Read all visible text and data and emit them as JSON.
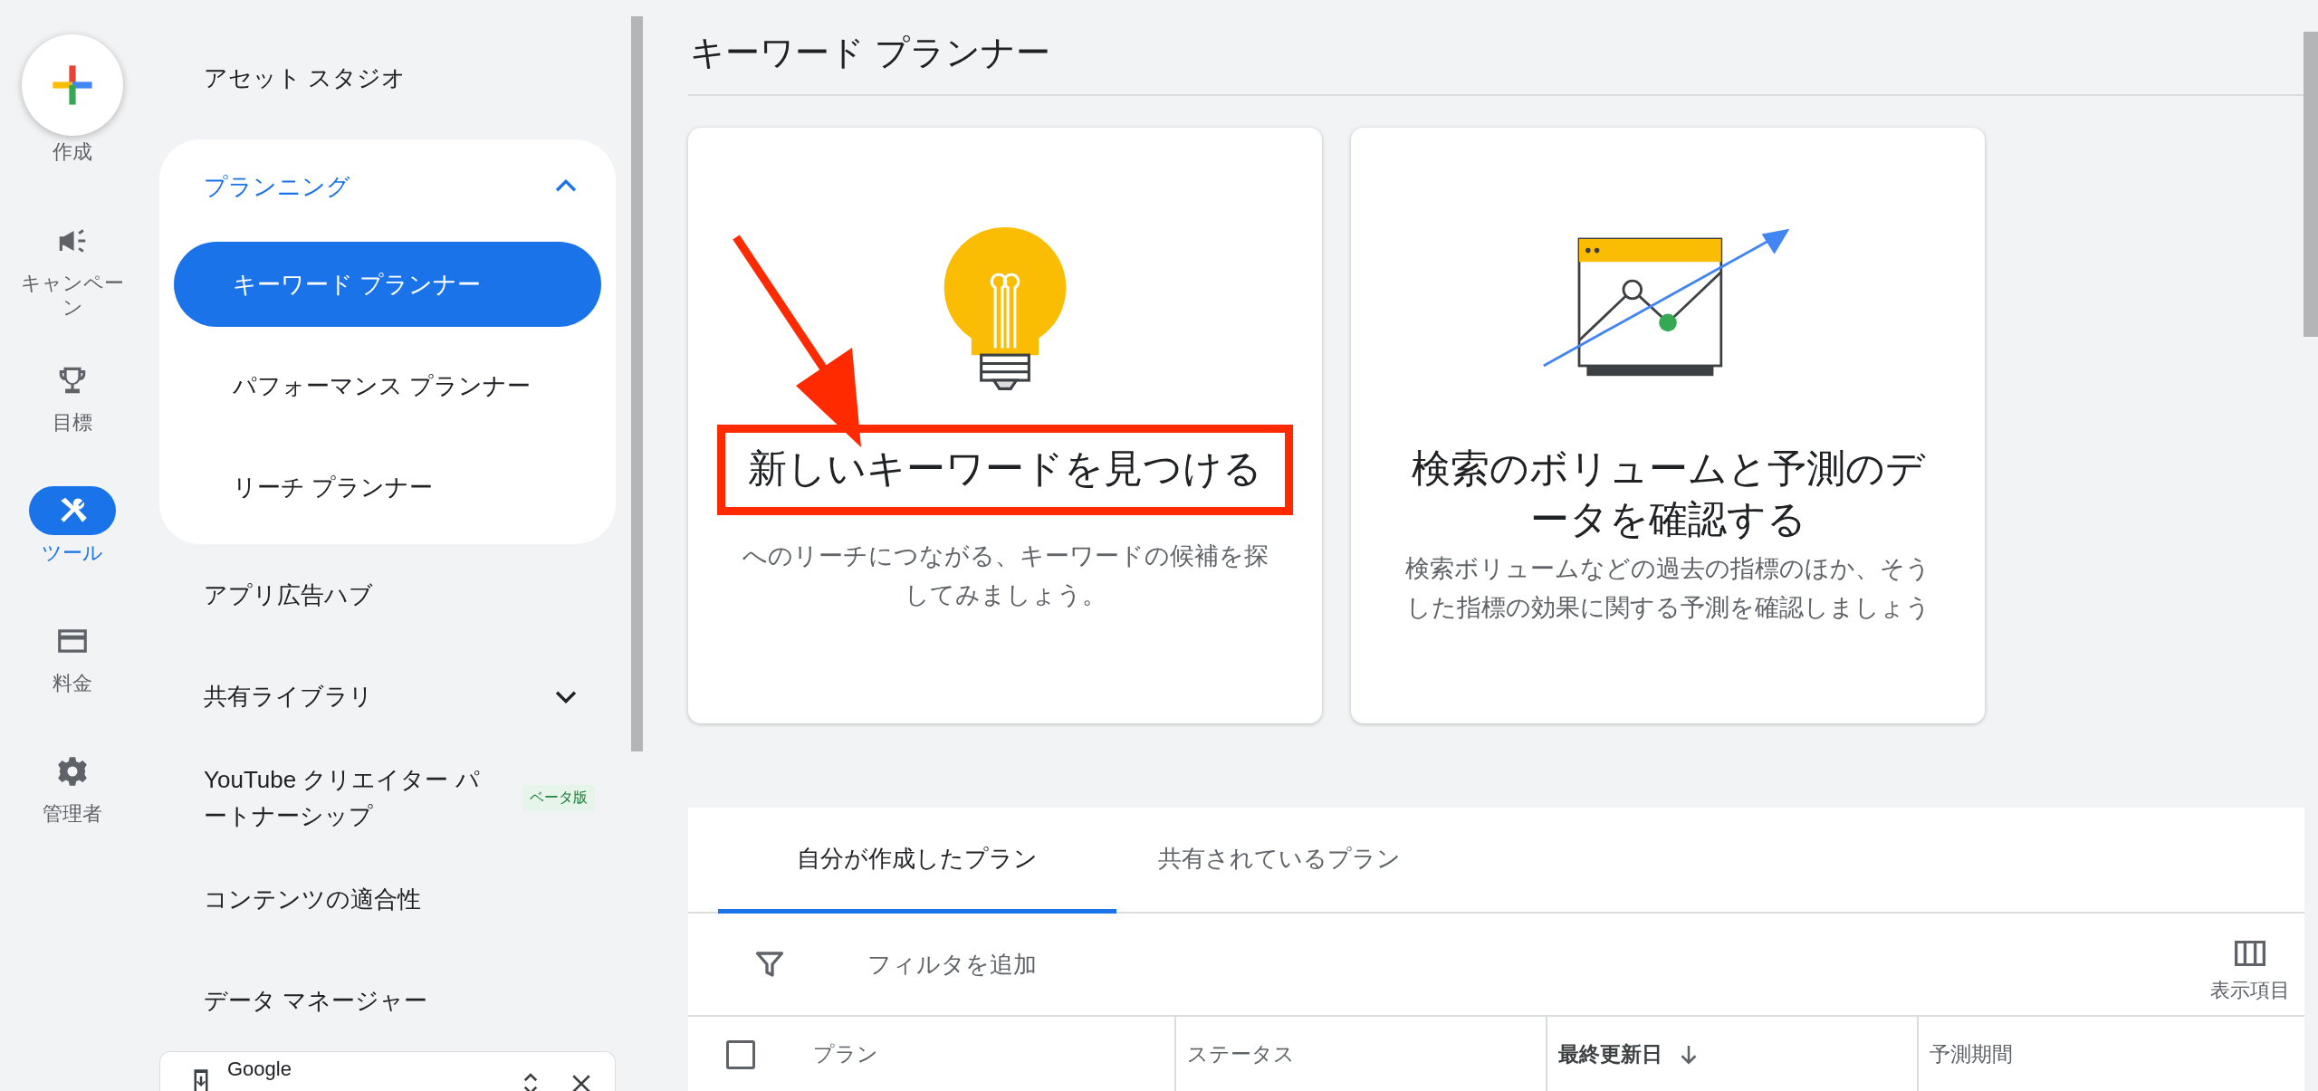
{
  "rail": {
    "create": {
      "label": "作成"
    },
    "items": [
      {
        "label": "キャンペーン",
        "selected": false
      },
      {
        "label": "目標",
        "selected": false
      },
      {
        "label": "ツール",
        "selected": true
      },
      {
        "label": "料金",
        "selected": false
      },
      {
        "label": "管理者",
        "selected": false
      }
    ]
  },
  "sidebar": {
    "items": [
      {
        "kind": "link",
        "label": "アセット スタジオ"
      },
      {
        "kind": "group",
        "label": "プランニング",
        "expanded": true,
        "children": [
          {
            "label": "キーワード プランナー",
            "selected": true
          },
          {
            "label": "パフォーマンス プランナー",
            "selected": false
          },
          {
            "label": "リーチ プランナー",
            "selected": false
          }
        ]
      },
      {
        "kind": "link",
        "label": "アプリ広告ハブ"
      },
      {
        "kind": "group",
        "label": "共有ライブラリ",
        "expanded": false
      },
      {
        "kind": "link",
        "label": "YouTube クリエイター パートナーシップ",
        "badge": "ベータ版"
      },
      {
        "kind": "link",
        "label": "コンテンツの適合性"
      },
      {
        "kind": "link",
        "label": "データ マネージャー"
      }
    ],
    "notification": {
      "title": "Google"
    }
  },
  "page": {
    "title": "キーワード プランナー",
    "cards": [
      {
        "title": "新しいキーワードを見つける",
        "description": "へのリーチにつながる、キーワードの候補を探してみましょう。",
        "highlighted": true
      },
      {
        "title": "検索のボリュームと予測のデータを確認する",
        "description": "検索ボリュームなどの過去の指標のほか、そうした指標の効果に関する予測を確認しましょう",
        "highlighted": false
      }
    ],
    "plans": {
      "tabs": [
        {
          "label": "自分が作成したプラン",
          "selected": true
        },
        {
          "label": "共有されているプラン",
          "selected": false
        }
      ],
      "filter": {
        "placeholder": "フィルタを追加"
      },
      "columns_button": "表示項目",
      "select_all": {
        "checked": false
      },
      "columns": [
        {
          "label": "プラン",
          "sorted": false
        },
        {
          "label": "ステータス",
          "sorted": false
        },
        {
          "label": "最終更新日",
          "sorted": true
        },
        {
          "label": "予測期間",
          "sorted": false
        }
      ]
    }
  }
}
